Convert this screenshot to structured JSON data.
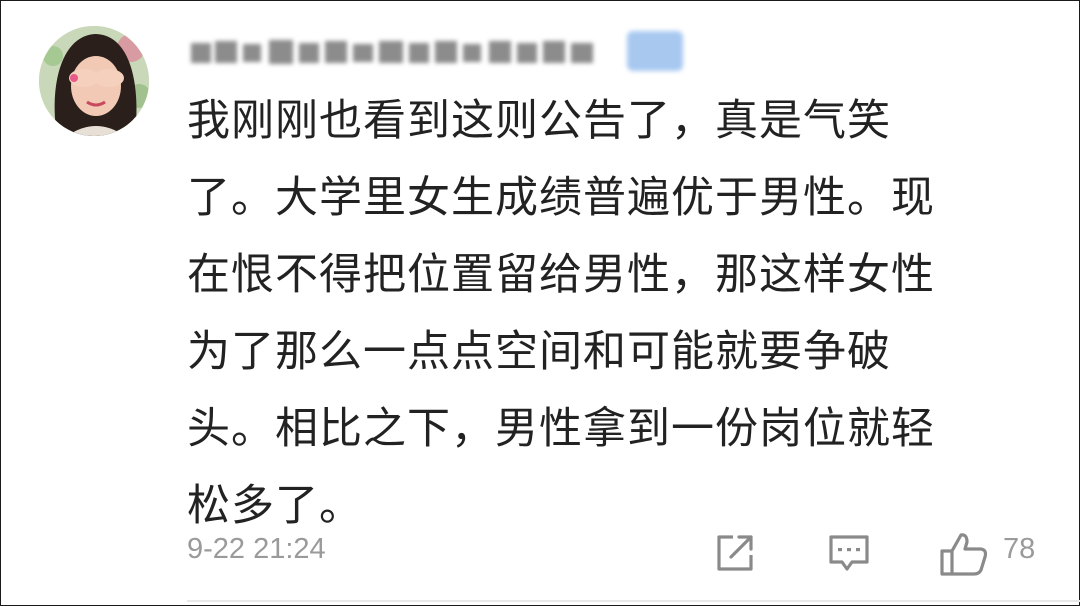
{
  "comment": {
    "text": "我刚刚也看到这则公告了，真是气笑\n了。大学里女生成绩普遍优于男性。现\n在恨不得把位置留给男性，那这样女性\n为了那么一点点空间和可能就要争破\n头。相比之下，男性拿到一份岗位就轻\n松多了。",
    "timestamp": "9-22 21:24",
    "like_count": "78"
  },
  "icons": {
    "avatar": "avatar",
    "share": "share-icon",
    "reply": "comment-icon",
    "like": "thumbs-up-icon"
  },
  "colors": {
    "text": "#222222",
    "meta": "#9a9a9a",
    "vip_badge": "#a8c8f0"
  }
}
